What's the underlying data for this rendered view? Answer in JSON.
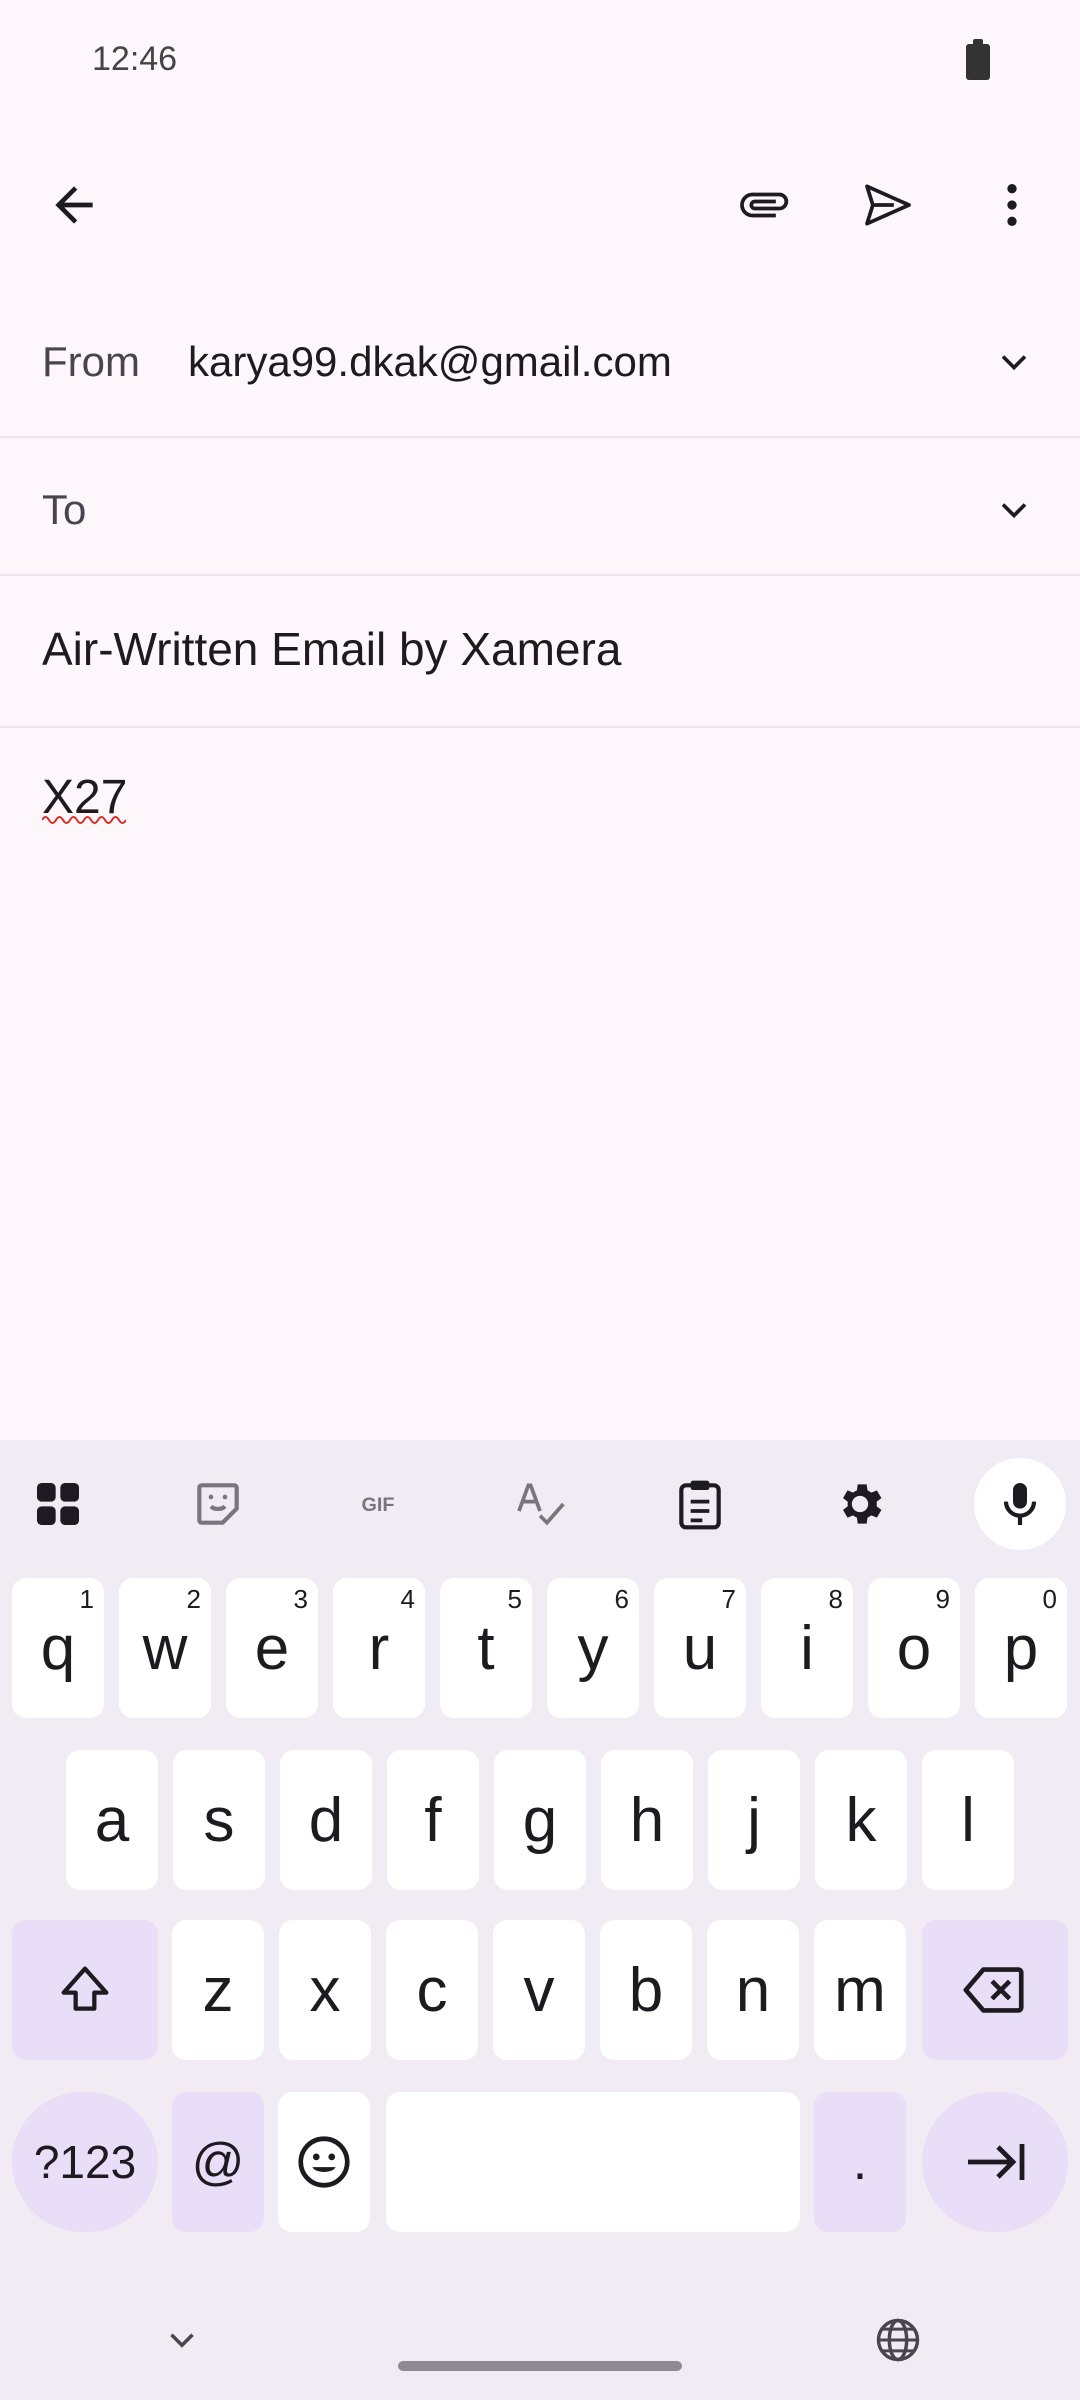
{
  "status_bar": {
    "time": "12:46"
  },
  "compose": {
    "from_label": "From",
    "from_value": "karya99.dkak@gmail.com",
    "to_label": "To",
    "subject": "Air-Written Email by Xamera",
    "body": "X27"
  },
  "keyboard": {
    "row1": [
      {
        "key": "q",
        "hint": "1"
      },
      {
        "key": "w",
        "hint": "2"
      },
      {
        "key": "e",
        "hint": "3"
      },
      {
        "key": "r",
        "hint": "4"
      },
      {
        "key": "t",
        "hint": "5"
      },
      {
        "key": "y",
        "hint": "6"
      },
      {
        "key": "u",
        "hint": "7"
      },
      {
        "key": "i",
        "hint": "8"
      },
      {
        "key": "o",
        "hint": "9"
      },
      {
        "key": "p",
        "hint": "0"
      }
    ],
    "row2": [
      "a",
      "s",
      "d",
      "f",
      "g",
      "h",
      "j",
      "k",
      "l"
    ],
    "row3": [
      "z",
      "x",
      "c",
      "v",
      "b",
      "n",
      "m"
    ],
    "symbols_label": "?123",
    "at_label": "@",
    "period_label": ".",
    "toolbar_icons": [
      "apps-grid-icon",
      "sticker-icon",
      "gif-icon",
      "spellcheck-icon",
      "clipboard-icon",
      "settings-icon",
      "mic-icon"
    ]
  },
  "colors": {
    "background": "#fdf7fc",
    "keyboard_bg": "#f1ecf4",
    "modifier_key": "#e8def8",
    "key": "#ffffff",
    "spell_error": "#d93025"
  }
}
